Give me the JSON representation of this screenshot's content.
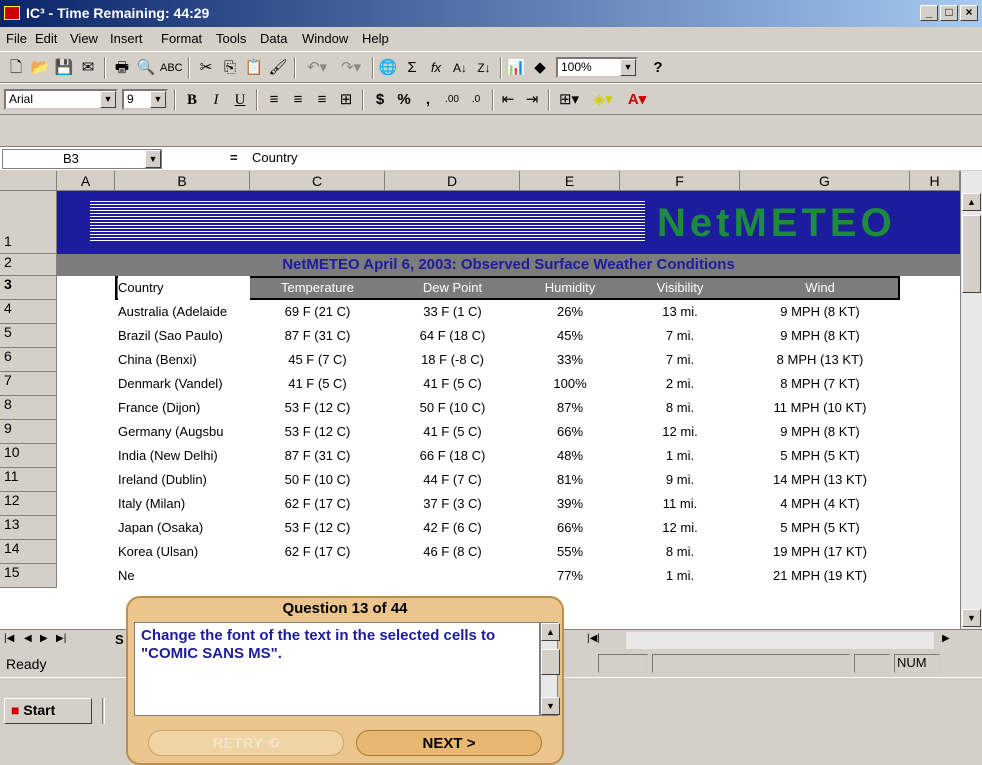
{
  "window": {
    "title": "IC³ - Time Remaining:   44:29",
    "min": "_",
    "max": "□",
    "close": "×"
  },
  "menu": [
    "File",
    "Edit",
    "View",
    "Insert",
    "Format",
    "Tools",
    "Data",
    "Window",
    "Help"
  ],
  "toolbar": {
    "zoom": "100%",
    "font": "Arial",
    "size": "9",
    "dollar": "$",
    "percent": "%",
    "comma": ",",
    "sigma": "Σ",
    "fx": "fx",
    "bold": "B",
    "italic": "I",
    "underline": "U",
    "help": "?"
  },
  "formula": {
    "cell_ref": "B3",
    "equals": "=",
    "content": "Country"
  },
  "columns": [
    "A",
    "B",
    "C",
    "D",
    "E",
    "F",
    "G",
    "H"
  ],
  "rows": [
    "1",
    "2",
    "3",
    "4",
    "5",
    "6",
    "7",
    "8",
    "9",
    "10",
    "11",
    "12",
    "13",
    "14",
    "15"
  ],
  "banner": {
    "logo": "NetMETEO",
    "subtitle": "NetMETEO April 6, 2003: Observed Surface Weather Conditions"
  },
  "table": {
    "headers": [
      "Country",
      "Temperature",
      "Dew Point",
      "Humidity",
      "Visibility",
      "Wind"
    ],
    "rows": [
      [
        "Australia (Adelaide",
        "69 F (21 C)",
        "33 F (1 C)",
        "26%",
        "13 mi.",
        "9 MPH  (8 KT)"
      ],
      [
        "Brazil (Sao Paulo)",
        "87 F (31 C)",
        "64 F (18 C)",
        "45%",
        "7 mi.",
        "9 MPH (8 KT)"
      ],
      [
        "China (Benxi)",
        "45 F (7 C)",
        "18 F (-8 C)",
        "33%",
        "7 mi.",
        "8 MPH (13 KT)"
      ],
      [
        "Denmark (Vandel)",
        "41 F (5 C)",
        "41 F (5 C)",
        "100%",
        "2 mi.",
        "8 MPH (7 KT)"
      ],
      [
        "France (Dijon)",
        "53 F (12 C)",
        "50 F (10 C)",
        "87%",
        "8 mi.",
        "11 MPH (10 KT)"
      ],
      [
        "Germany (Augsbu",
        "53 F (12 C)",
        "41 F (5 C)",
        "66%",
        "12 mi.",
        "9 MPH (8 KT)"
      ],
      [
        "India (New Delhi)",
        "87 F (31 C)",
        "66 F (18 C)",
        "48%",
        "1 mi.",
        "5 MPH (5 KT)"
      ],
      [
        "Ireland (Dublin)",
        "50 F (10 C)",
        "44 F (7 C)",
        "81%",
        "9 mi.",
        "14 MPH (13 KT)"
      ],
      [
        "Italy (Milan)",
        "62 F (17 C)",
        "37 F (3 C)",
        "39%",
        "11 mi.",
        "4 MPH (4 KT)"
      ],
      [
        "Japan (Osaka)",
        "53 F (12 C)",
        "42 F (6 C)",
        "66%",
        "12 mi.",
        "5 MPH (5 KT)"
      ],
      [
        "Korea (Ulsan)",
        "62 F (17 C)",
        "46 F (8 C)",
        "55%",
        "8 mi.",
        "19 MPH (17 KT)"
      ],
      [
        "Ne",
        "",
        "",
        "77%",
        "1 mi.",
        "21 MPH (19 KT)"
      ]
    ]
  },
  "sheet_tab": "S",
  "status": {
    "ready": "Ready",
    "num": "NUM"
  },
  "taskbar": {
    "start": "Start"
  },
  "question": {
    "title": "Question 13 of 44",
    "text": "Change the font of the text in the selected cells to \"COMIC SANS MS\".",
    "retry": "RETRY",
    "next": "NEXT >"
  }
}
